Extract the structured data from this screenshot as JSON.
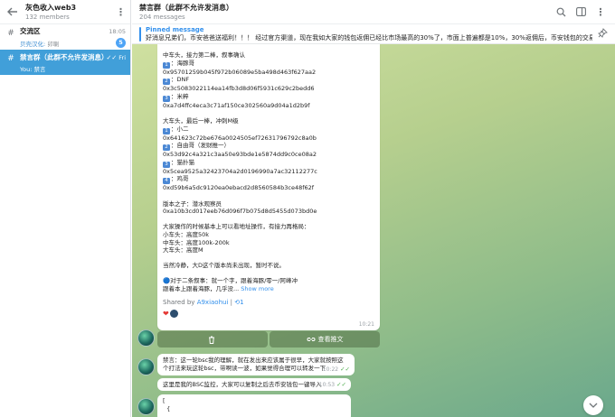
{
  "sidebar": {
    "title": "灰色收入web3",
    "subtitle": "132 members",
    "chats": [
      {
        "icon": "hashtag-icon",
        "title": "交流区",
        "time": "18:05",
        "sender": "贝壳汉化: ",
        "preview": "卯喇",
        "badge": "5"
      },
      {
        "icon": "hashtag-icon",
        "title": "禁言群（此群不允许发消息）",
        "time": "Fri",
        "sender": "You: ",
        "preview": "禁言"
      }
    ]
  },
  "header": {
    "title": "禁言群（此群不允许发消息）",
    "subtitle": "204 messages"
  },
  "pinned": {
    "title": "Pinned message",
    "text": "好消息兄弟们，币安爸爸送福利！！！ 经过官方渠道，现在我如大家的钱包返佣已经比市场最高的30%了，市面上普遍都是10%，30%返佣后，币安钱包的交易手续费也…"
  },
  "message": {
    "lines": [
      "中车头，接力第二棒，叙事确认",
      "1️⃣：海豚哥",
      "0x95701259b045f972b06089e5ba498d463f627aa2",
      "2️⃣：DNF",
      "0x3c5083022114ea14fb3d8d06f5931c629c2bedd6",
      "3️⃣：米粹",
      "0xa7d4ffc4eca3c71af150ce302560a9d04a1d2b9f",
      "",
      "大车头，最后一棒，冲刺M级",
      "1️⃣：小二",
      "0x641623c72be676a0024505ef72631796792c8a0b",
      "2️⃣：自由哥（发财推一）",
      "0x53d92c4a321c3aa50e93bde1e5874dd9c0ce08a2",
      "3️⃣：猫扑猫",
      "0x5cea9525a32423704a2d0196990a7ac32112277c",
      "4️⃣：鸡哥",
      "0xd59b6a5dc9120ea0ebacd2d8560584b3ce48f62f",
      "",
      "版本之子：潜水观察员",
      "0xa10b3cd017eeb76d096f7b075d8d5455d073bd0e",
      "",
      "大家操作的时候基本上可以看地址操作，有接力再格局：",
      "小车头：高度50k",
      "中车头：高度100k-200k",
      "大车头：高度M",
      "",
      "当然冷静，大D这个版本尚未出现，暂时不说。",
      "",
      "🔵对于二条叙事：就一个字，跟着海豚/零一/阿峰冲",
      "跟着本上跟着海豚，几乎没..."
    ],
    "show_more": "Show more",
    "shared_label": "Shared by ",
    "shared_by": "A9xiaohui",
    "shared_sep": " | ",
    "shared_count": "1",
    "time": "10:21",
    "buttons": [
      {
        "label": "",
        "icon": "trash-icon"
      },
      {
        "label": "查看推文",
        "icon": "link-icon"
      }
    ]
  },
  "messages": [
    {
      "text": "禁言：这一轮bsc我的理解，就在发出来应该属于很早，大家就按照这个打法来玩这轮bsc，带啊读一波，如果觉得合理可以转发一下",
      "time": "10:22"
    },
    {
      "text": "这里是我的BSC监控，大家可以复制之后去币安钱包一键导入",
      "time": "10:53"
    },
    {
      "text": "[\n  {"
    }
  ],
  "colors": {
    "accent": "#3390ec",
    "active_chat": "#419fd9",
    "badge": "#4ea4f6"
  }
}
